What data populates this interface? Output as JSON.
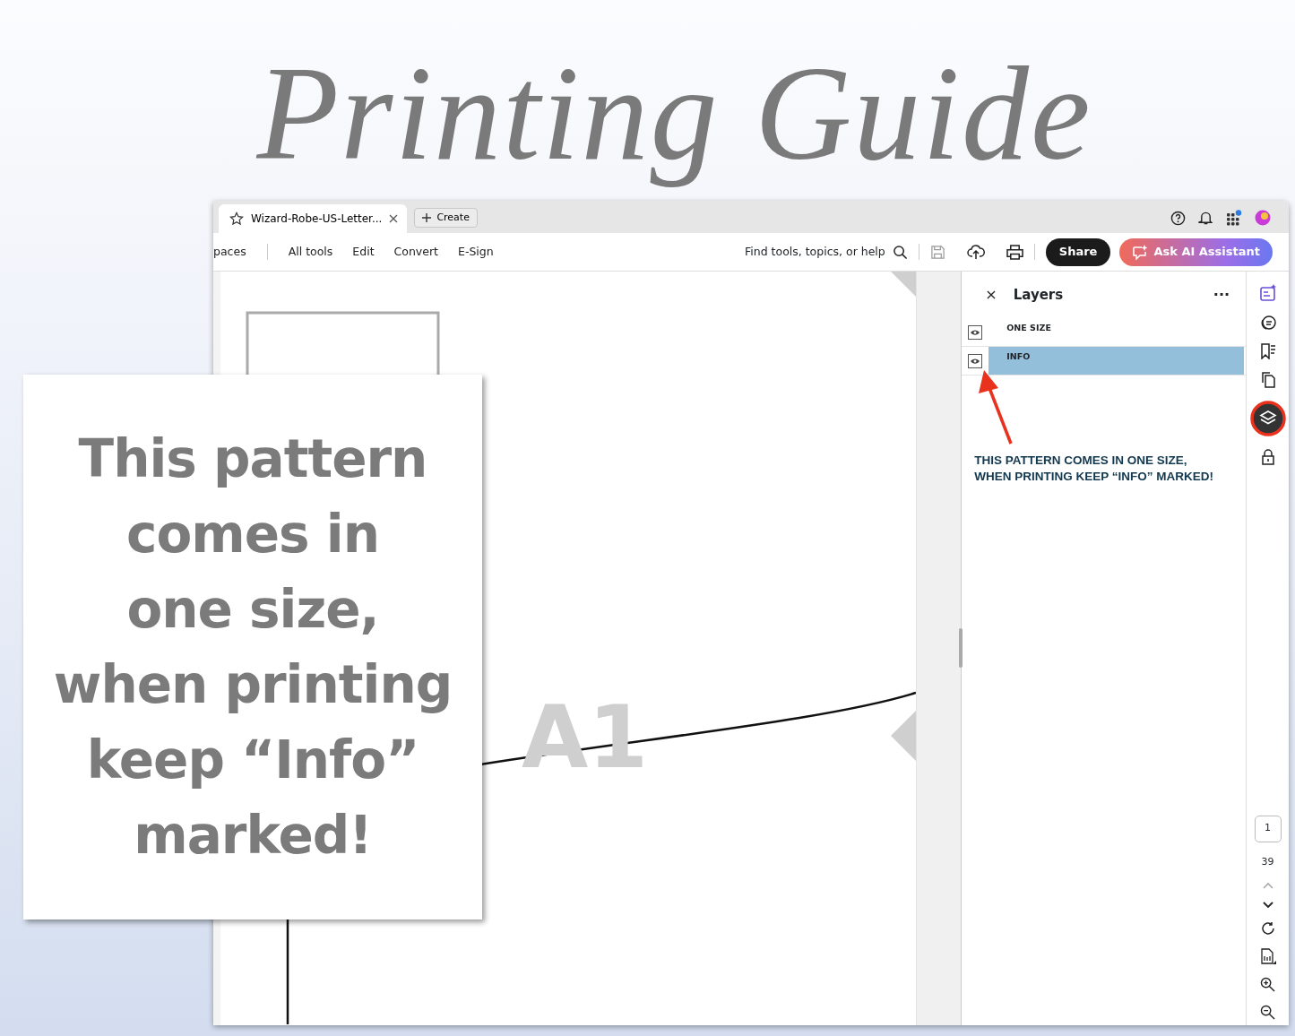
{
  "heading": "Printing Guide",
  "callout": {
    "lines": [
      "This pattern",
      "comes in",
      "one size,",
      "when printing",
      "keep “Info”",
      "marked!"
    ]
  },
  "window": {
    "tab": {
      "title": "Wizard-Robe-US-Letter...",
      "selected": true
    },
    "create_button": "Create",
    "toolbar": {
      "items": [
        {
          "label": "paces"
        },
        {
          "label": "All tools"
        },
        {
          "label": "Edit"
        },
        {
          "label": "Convert"
        },
        {
          "label": "E-Sign"
        }
      ],
      "search_label": "Find tools, topics, or help",
      "share": "Share",
      "ai_button": "Ask AI Assistant"
    },
    "page": {
      "piece_label": "A1"
    },
    "layers_panel": {
      "title": "Layers",
      "more": "···",
      "close": "×",
      "layers": [
        {
          "name": "ONE SIZE",
          "visible": true,
          "selected": false
        },
        {
          "name": "INFO",
          "visible": true,
          "selected": true
        }
      ],
      "note_lines": [
        "THIS PATTERN COMES IN ONE SIZE,",
        "WHEN PRINTING KEEP “INFO” MARKED!"
      ]
    },
    "rail": {
      "page_number": "1",
      "page_count": "39"
    }
  }
}
